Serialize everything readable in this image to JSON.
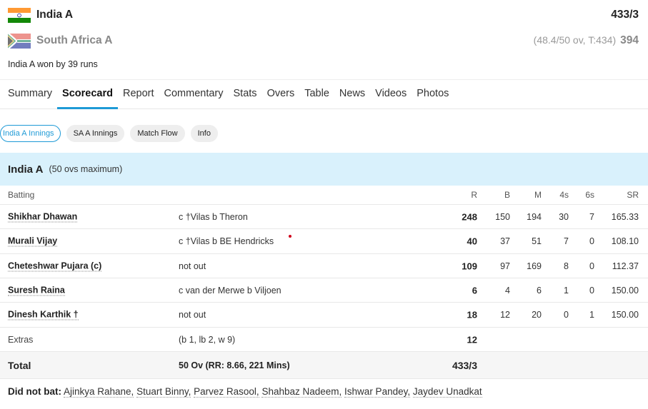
{
  "teams": [
    {
      "name": "India A",
      "overs": "",
      "score": "433/3",
      "flag": "india-flag-icon"
    },
    {
      "name": "South Africa A",
      "overs": "(48.4/50 ov, T:434)",
      "score": "394",
      "flag": "south-africa-flag-icon"
    }
  ],
  "result": "India A won by 39 runs",
  "tabs": [
    "Summary",
    "Scorecard",
    "Report",
    "Commentary",
    "Stats",
    "Overs",
    "Table",
    "News",
    "Videos",
    "Photos"
  ],
  "active_tab": "Scorecard",
  "pills": [
    "India A Innings",
    "SA A Innings",
    "Match Flow",
    "Info"
  ],
  "innings": {
    "team": "India A",
    "note": "(50 ovs maximum)",
    "headers": {
      "batting": "Batting",
      "r": "R",
      "b": "B",
      "m": "M",
      "fours": "4s",
      "sixes": "6s",
      "sr": "SR"
    },
    "batsmen": [
      {
        "name": "Shikhar Dhawan",
        "dismissal": "c †Vilas b Theron",
        "r": "248",
        "b": "150",
        "m": "194",
        "fours": "30",
        "sixes": "7",
        "sr": "165.33"
      },
      {
        "name": "Murali Vijay",
        "dismissal": "c †Vilas b BE Hendricks",
        "r": "40",
        "b": "37",
        "m": "51",
        "fours": "7",
        "sixes": "0",
        "sr": "108.10"
      },
      {
        "name": "Cheteshwar Pujara (c)",
        "dismissal": "not out",
        "r": "109",
        "b": "97",
        "m": "169",
        "fours": "8",
        "sixes": "0",
        "sr": "112.37"
      },
      {
        "name": "Suresh Raina",
        "dismissal": "c van der Merwe b Viljoen",
        "r": "6",
        "b": "4",
        "m": "6",
        "fours": "1",
        "sixes": "0",
        "sr": "150.00"
      },
      {
        "name": "Dinesh Karthik †",
        "dismissal": "not out",
        "r": "18",
        "b": "12",
        "m": "20",
        "fours": "0",
        "sixes": "1",
        "sr": "150.00"
      }
    ],
    "extras": {
      "label": "Extras",
      "detail": "(b 1, lb 2, w 9)",
      "value": "12"
    },
    "total": {
      "label": "Total",
      "detail": "50 Ov (RR: 8.66, 221 Mins)",
      "value": "433/3"
    },
    "did_not_bat": {
      "label": "Did not bat:",
      "players": [
        "Ajinkya Rahane,",
        "Stuart Binny,",
        "Parvez Rasool,",
        "Shahbaz Nadeem,",
        "Ishwar Pandey,",
        "Jaydev Unadkat"
      ]
    }
  },
  "colors": {
    "accent": "#1e9ad6",
    "header_bg": "#d9f1fc",
    "india_saffron": "#ff9933",
    "india_green": "#138808"
  }
}
